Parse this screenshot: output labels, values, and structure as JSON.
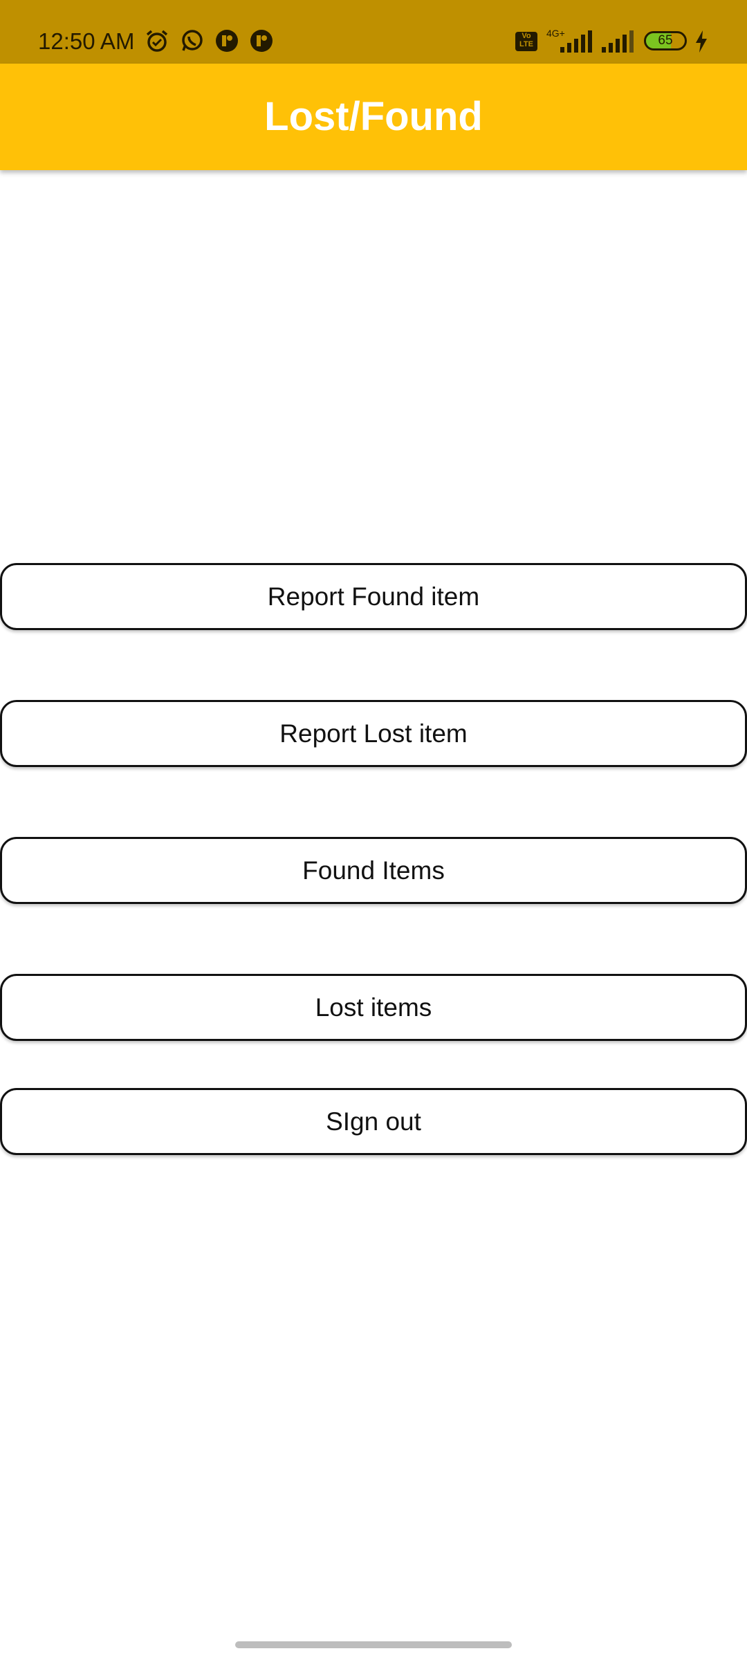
{
  "status_bar": {
    "time": "12:50 AM",
    "notification_icons": [
      "alarm-icon",
      "whatsapp-icon",
      "app-notification-icon",
      "app-notification-icon"
    ],
    "volte": "Vo LTE",
    "network": "4G+",
    "battery_percent": "65",
    "battery_level": 0.65,
    "charging": true
  },
  "app_bar": {
    "title": "Lost/Found"
  },
  "menu": {
    "report_found": "Report Found item",
    "report_lost": "Report Lost item",
    "found_items": "Found Items",
    "lost_items": "Lost items",
    "sign_out": "SIgn out"
  },
  "colors": {
    "status_bar": "#bf9000",
    "app_bar": "#ffc107",
    "app_bar_title": "#ffffff",
    "button_border": "#111111",
    "battery_fill": "#7bc420"
  }
}
